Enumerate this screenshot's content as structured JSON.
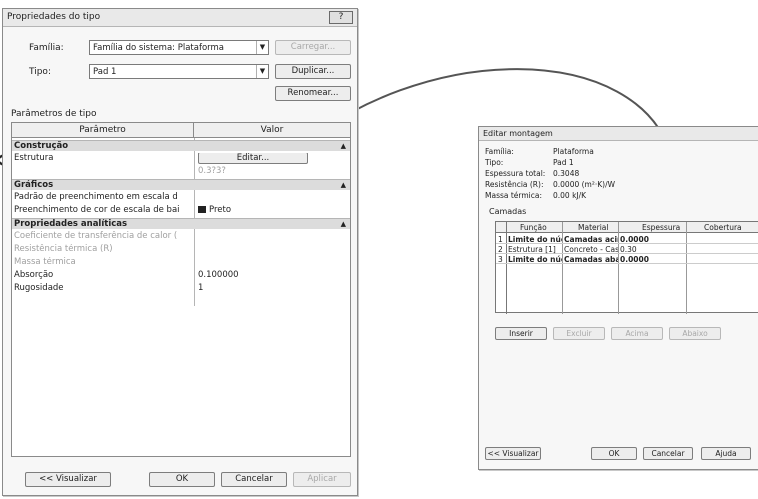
{
  "type_dialog": {
    "title": "Propriedades do tipo",
    "close": "?",
    "family_label": "Família:",
    "family_value": "Família do sistema: Plataforma",
    "load_button": "Carregar...",
    "type_label": "Tipo:",
    "type_value": "Pad 1",
    "duplicate_button": "Duplicar...",
    "rename_button": "Renomear...",
    "params_label": "Parâmetros de tipo",
    "col_param": "Parâmetro",
    "col_value": "Valor",
    "groups": {
      "construction": "Construção",
      "graphics": "Gráficos",
      "analytic": "Propriedades analíticas"
    },
    "rows": {
      "structure": "Estrutura",
      "edit_button": "Editar...",
      "thickness_value": "0.3?3?",
      "coarse_pattern": "Padrão de preenchimento em escala d",
      "coarse_color": "Preenchimento de cor de escala de bai",
      "coarse_color_value": "Preto",
      "heat_coeff": "Coeficiente de transferência de calor (",
      "thermal_res": "Resistência térmica (R)",
      "thermal_mass": "Massa térmica",
      "absorption": "Absorção",
      "absorption_value": "0.100000",
      "roughness": "Rugosidade",
      "roughness_value": "1"
    },
    "preview_button": "<< Visualizar",
    "ok_button": "OK",
    "cancel_button": "Cancelar",
    "apply_button": "Aplicar"
  },
  "assembly_dialog": {
    "title": "Editar montagem",
    "info": [
      {
        "label": "Família:",
        "value": "Plataforma"
      },
      {
        "label": "Tipo:",
        "value": "Pad 1"
      },
      {
        "label": "Espessura total:",
        "value": "0.3048"
      },
      {
        "label": "Resistência (R):",
        "value": "0.0000 (m²·K)/W"
      },
      {
        "label": "Massa térmica:",
        "value": "0.00 kJ/K"
      }
    ],
    "layers_label": "Camadas",
    "cols": [
      "Função",
      "Material",
      "Espessura",
      "Cobertura"
    ],
    "layers": [
      {
        "num": "1",
        "function": "Limite do núcleo",
        "material": "Camadas acima",
        "thickness": "0.0000"
      },
      {
        "num": "2",
        "function": "Estrutura [1]",
        "material": "Concreto - Cas",
        "thickness": "0.30"
      },
      {
        "num": "3",
        "function": "Limite do núcleo",
        "material": "Camadas abaixo",
        "thickness": "0.0000"
      }
    ],
    "buttons": [
      "Inserir",
      "Excluir",
      "Acima",
      "Abaixo"
    ],
    "preview_button": "<< Visualizar",
    "ok_button": "OK",
    "cancel_button": "Cancelar",
    "help_button": "Ajuda"
  }
}
